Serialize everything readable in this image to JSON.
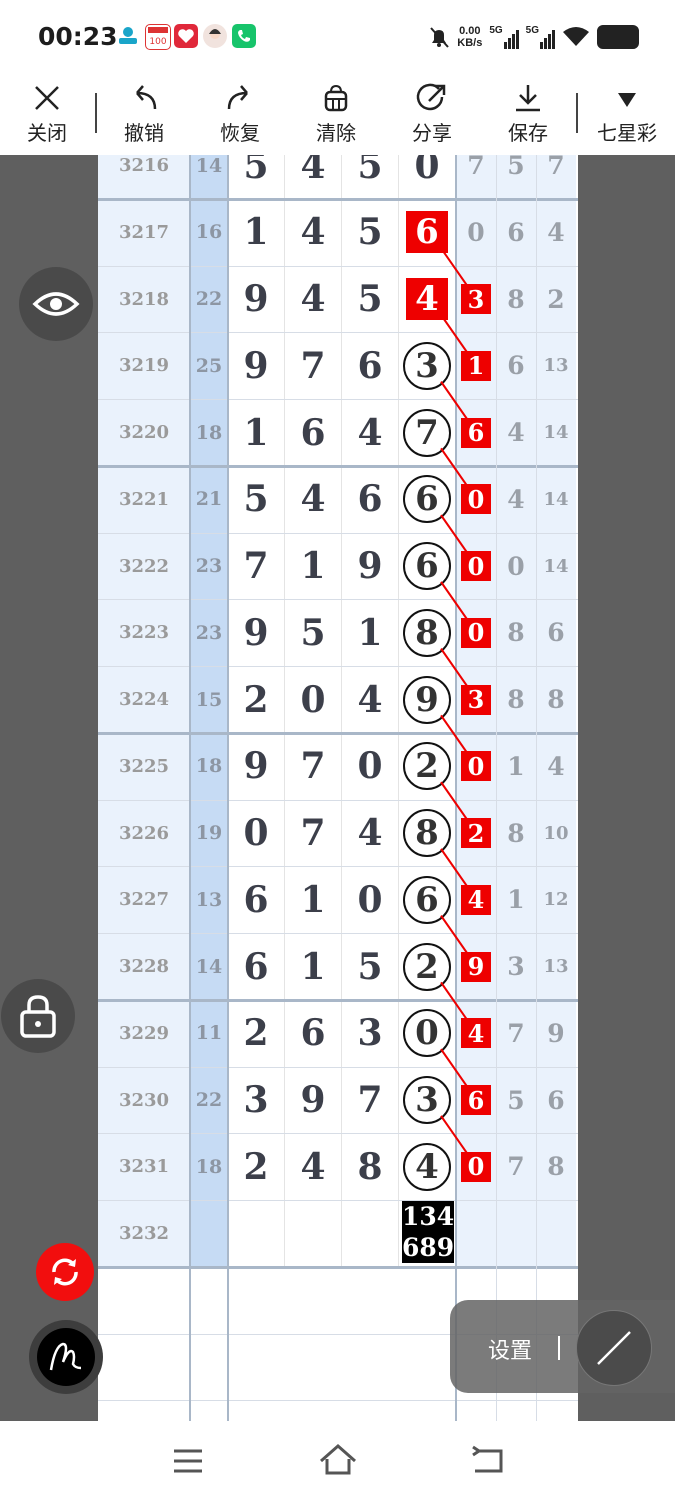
{
  "status": {
    "time": "00:23",
    "net_speed": "0.00",
    "net_unit": "KB/s",
    "sig1": "5G",
    "sig2": "5G"
  },
  "toolbar": [
    {
      "label": "关闭",
      "icon": "close-icon"
    },
    {
      "label": "撤销",
      "icon": "undo-icon"
    },
    {
      "label": "恢复",
      "icon": "redo-icon"
    },
    {
      "label": "清除",
      "icon": "clear-icon"
    },
    {
      "label": "分享",
      "icon": "share-icon"
    },
    {
      "label": "保存",
      "icon": "save-icon"
    },
    {
      "label": "七星彩",
      "icon": "dropdown-triangle-icon"
    }
  ],
  "rows": [
    {
      "issue": "3216",
      "sum": "14",
      "d": [
        "5",
        "4",
        "5",
        "0"
      ],
      "e": "",
      "f": "7",
      "g": "5",
      "h": "7"
    },
    {
      "issue": "3217",
      "sum": "16",
      "d": [
        "1",
        "4",
        "5",
        "6"
      ],
      "e": "",
      "f": "0",
      "g": "6",
      "h": "4"
    },
    {
      "issue": "3218",
      "sum": "22",
      "d": [
        "9",
        "4",
        "5",
        "4"
      ],
      "e": "3",
      "f": "",
      "g": "8",
      "h": "2"
    },
    {
      "issue": "3219",
      "sum": "25",
      "d": [
        "9",
        "7",
        "6",
        "3"
      ],
      "e": "1",
      "f": "",
      "g": "6",
      "h": "13"
    },
    {
      "issue": "3220",
      "sum": "18",
      "d": [
        "1",
        "6",
        "4",
        "7"
      ],
      "e": "6",
      "f": "",
      "g": "4",
      "h": "14"
    },
    {
      "issue": "3221",
      "sum": "21",
      "d": [
        "5",
        "4",
        "6",
        "6"
      ],
      "e": "0",
      "f": "",
      "g": "4",
      "h": "14"
    },
    {
      "issue": "3222",
      "sum": "23",
      "d": [
        "7",
        "1",
        "9",
        "6"
      ],
      "e": "0",
      "f": "",
      "g": "0",
      "h": "14"
    },
    {
      "issue": "3223",
      "sum": "23",
      "d": [
        "9",
        "5",
        "1",
        "8"
      ],
      "e": "0",
      "f": "",
      "g": "8",
      "h": "6"
    },
    {
      "issue": "3224",
      "sum": "15",
      "d": [
        "2",
        "0",
        "4",
        "9"
      ],
      "e": "3",
      "f": "",
      "g": "8",
      "h": "8"
    },
    {
      "issue": "3225",
      "sum": "18",
      "d": [
        "9",
        "7",
        "0",
        "2"
      ],
      "e": "0",
      "f": "",
      "g": "1",
      "h": "4"
    },
    {
      "issue": "3226",
      "sum": "19",
      "d": [
        "0",
        "7",
        "4",
        "8"
      ],
      "e": "2",
      "f": "",
      "g": "8",
      "h": "10"
    },
    {
      "issue": "3227",
      "sum": "13",
      "d": [
        "6",
        "1",
        "0",
        "6"
      ],
      "e": "4",
      "f": "",
      "g": "1",
      "h": "12"
    },
    {
      "issue": "3228",
      "sum": "14",
      "d": [
        "6",
        "1",
        "5",
        "2"
      ],
      "e": "9",
      "f": "",
      "g": "3",
      "h": "13"
    },
    {
      "issue": "3229",
      "sum": "11",
      "d": [
        "2",
        "6",
        "3",
        "0"
      ],
      "e": "4",
      "f": "",
      "g": "7",
      "h": "9"
    },
    {
      "issue": "3230",
      "sum": "22",
      "d": [
        "3",
        "9",
        "7",
        "3"
      ],
      "e": "6",
      "f": "",
      "g": "5",
      "h": "6"
    },
    {
      "issue": "3231",
      "sum": "18",
      "d": [
        "2",
        "4",
        "8",
        "4"
      ],
      "e": "0",
      "f": "",
      "g": "7",
      "h": "8"
    },
    {
      "issue": "3232",
      "sum": "",
      "d": [
        "",
        "",
        "",
        ""
      ],
      "e": "",
      "f": "",
      "g": "",
      "h": ""
    }
  ],
  "prediction": {
    "line1": "134",
    "line2": "689"
  },
  "settings": {
    "label": "设置"
  },
  "colors": {
    "red": "#ee0000",
    "blue_column": "#c6dbf4",
    "light_column": "#eaf2fc"
  }
}
